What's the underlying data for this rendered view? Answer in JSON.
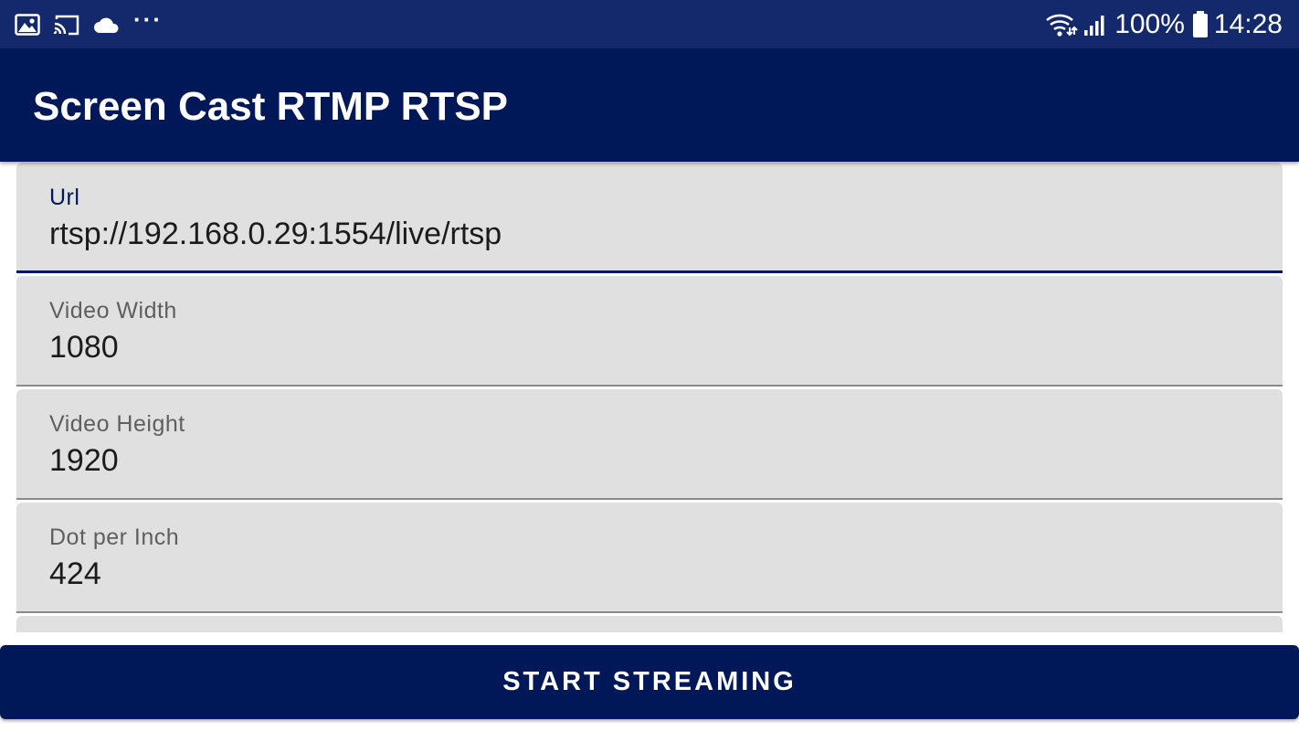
{
  "status_bar": {
    "left_icons": [
      "gallery-icon",
      "cast-icon",
      "cloud-icon",
      "more-dots-icon"
    ],
    "right_icons": [
      "wifi-icon",
      "signal-icon",
      "battery-icon"
    ],
    "more_dots": "···",
    "battery_percent": "100%",
    "time": "14:28"
  },
  "app_bar": {
    "title": "Screen Cast RTMP RTSP"
  },
  "form": {
    "url": {
      "label": "Url",
      "value": "rtsp://192.168.0.29:1554/live/rtsp"
    },
    "video_width": {
      "label": "Video Width",
      "value": "1080"
    },
    "video_height": {
      "label": "Video Height",
      "value": "1920"
    },
    "dpi": {
      "label": "Dot per Inch",
      "value": "424"
    }
  },
  "button": {
    "start_label": "START STREAMING"
  },
  "colors": {
    "status_bar": "#13296b",
    "primary": "#001858",
    "field_background": "#e0e0e0",
    "label": "#5f5f5f",
    "value": "#1b1b1b"
  }
}
